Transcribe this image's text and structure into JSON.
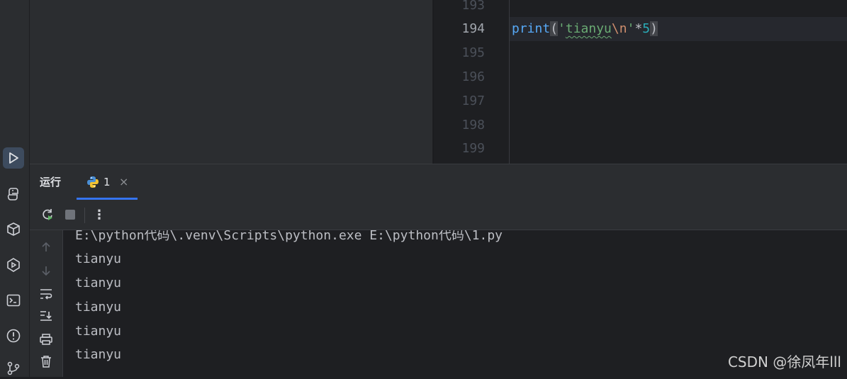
{
  "editor": {
    "line_numbers": [
      "193",
      "194",
      "195",
      "196",
      "197",
      "198",
      "199"
    ],
    "current_line": "194",
    "code": {
      "fn": "print",
      "open_paren": "(",
      "quote_open": "'",
      "string_text": "tianyu",
      "escape": "\\n",
      "quote_close": "'",
      "operator": "*",
      "number": "5",
      "close_paren": ")"
    }
  },
  "run_panel": {
    "title": "运行",
    "tab_label": "1",
    "tab_close": "×",
    "more_label": "⋮"
  },
  "console": {
    "lines": [
      "E:\\python代码\\.venv\\Scripts\\python.exe E:\\python代码\\1.py",
      "tianyu",
      "tianyu",
      "tianyu",
      "tianyu",
      "tianyu"
    ]
  },
  "watermark": "CSDN @徐凤年lll",
  "colors": {
    "accent": "#3574f0",
    "keyword": "#56a8f5",
    "string": "#6aab73",
    "escape": "#cf8e6d",
    "number": "#2aacb8"
  }
}
